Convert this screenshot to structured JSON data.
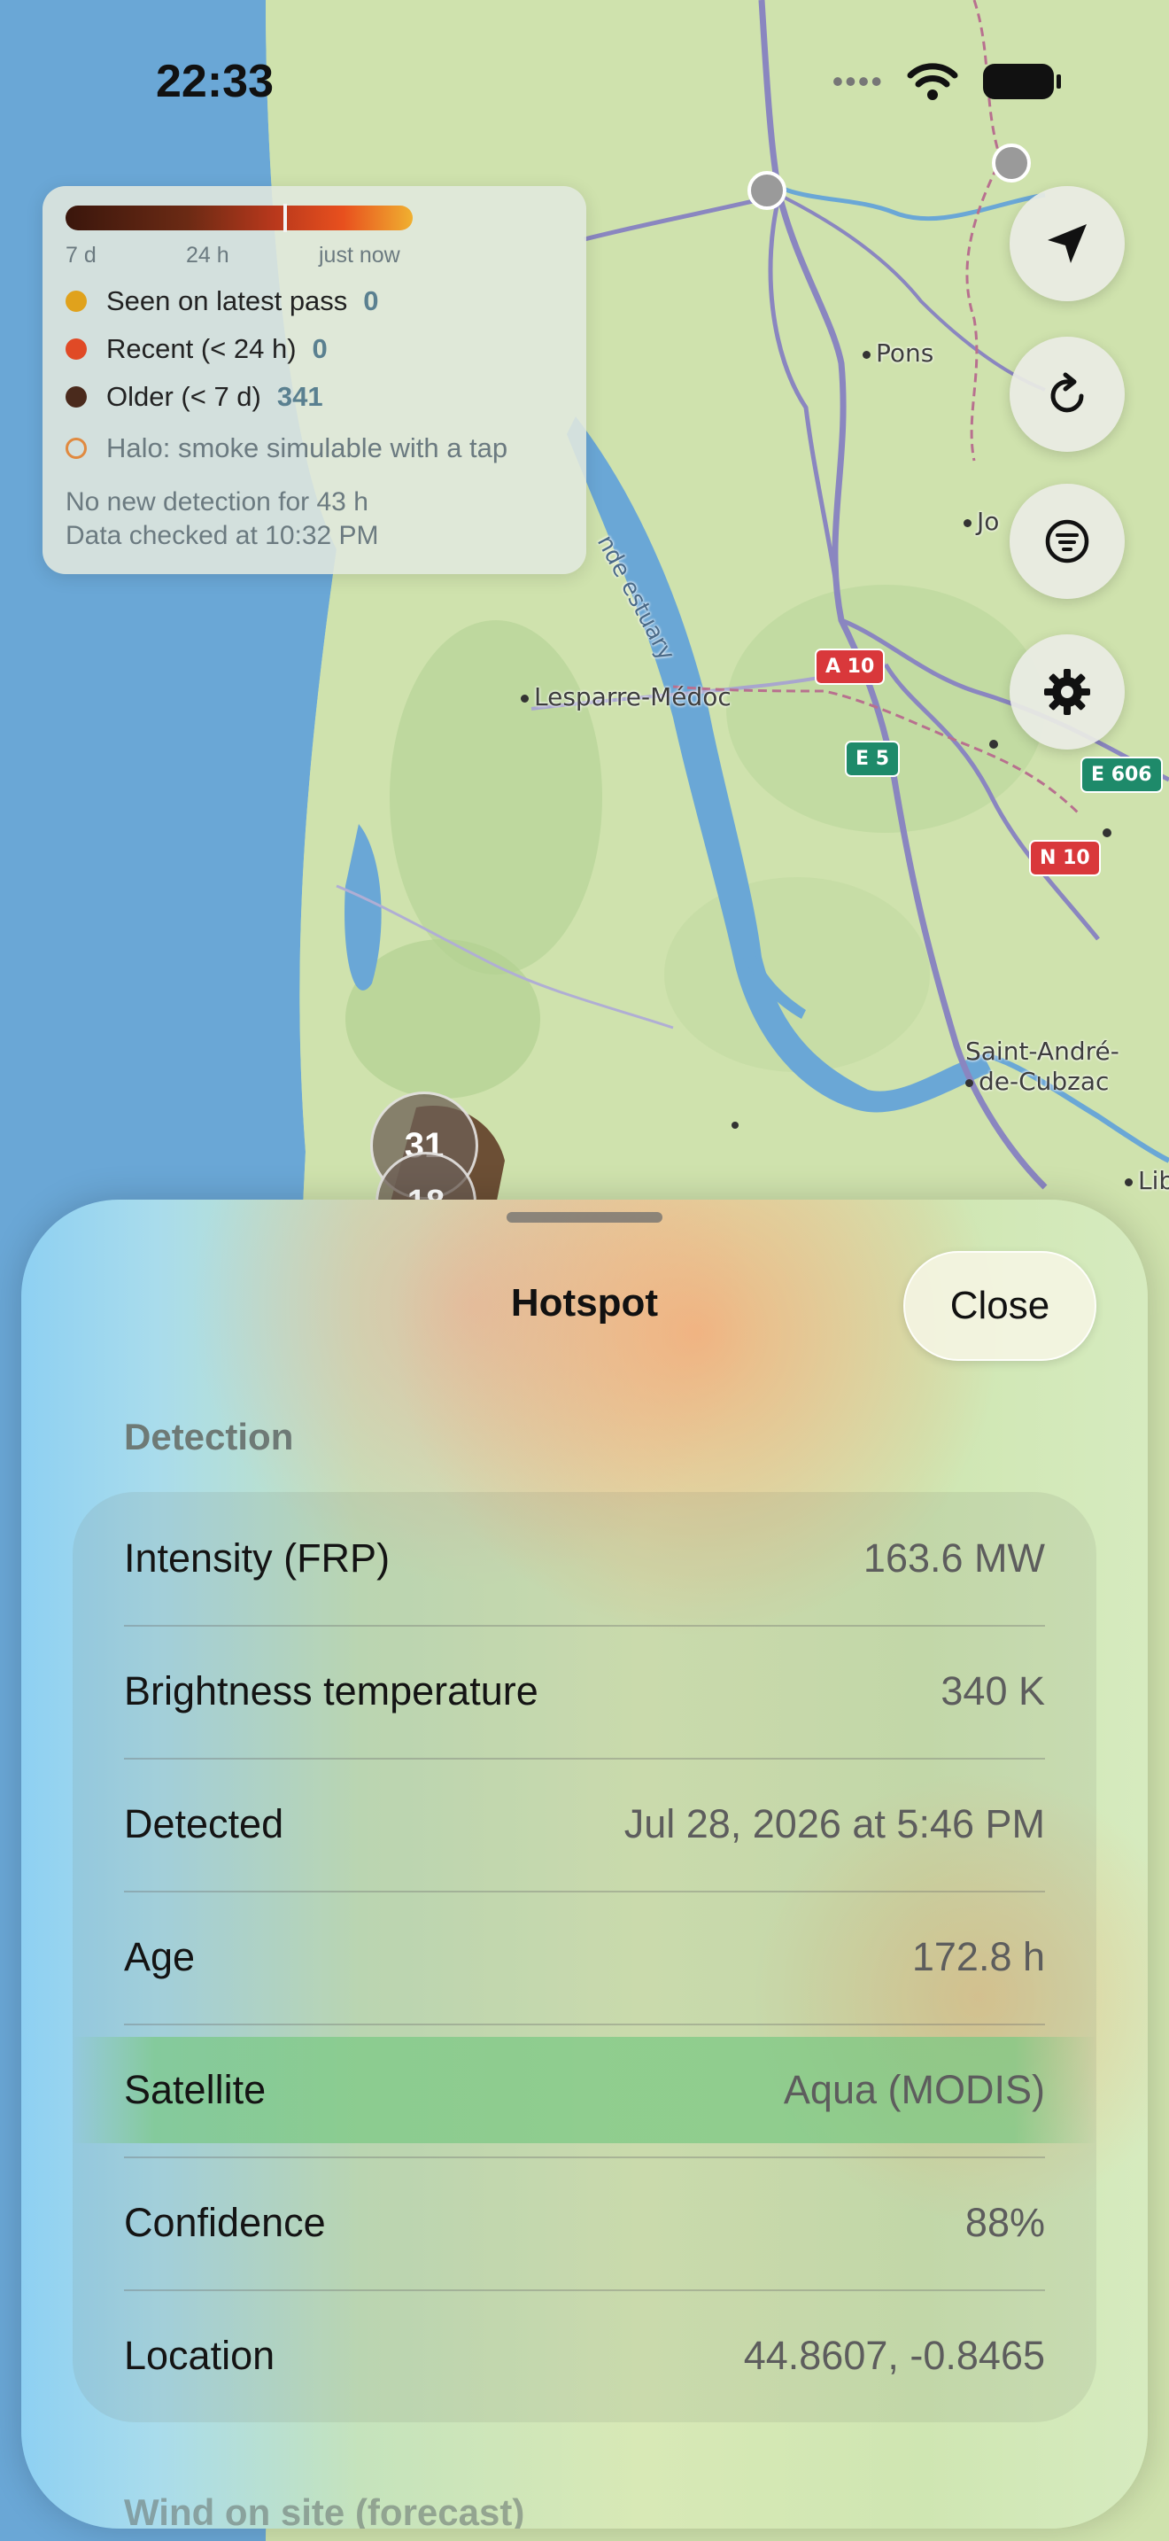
{
  "status_bar": {
    "time": "22:33"
  },
  "legend": {
    "scale_labels": [
      "7 d",
      "24 h",
      "just now"
    ],
    "rows": [
      {
        "label": "Seen on latest pass",
        "count": "0",
        "color": "#e0a21c"
      },
      {
        "label": "Recent (< 24 h)",
        "count": "0",
        "color": "#e04a26"
      },
      {
        "label": "Older (< 7 d)",
        "count": "341",
        "color": "#4a2a1c"
      }
    ],
    "halo_text": "Halo: smoke simulable with a tap",
    "halo_color": "#e08a40",
    "note_line1": "No new detection for 43 h",
    "note_line2": "Data checked at 10:32 PM"
  },
  "controls": [
    "location-arrow-icon",
    "refresh-icon",
    "filter-icon",
    "gear-icon"
  ],
  "map": {
    "places": [
      "Pons",
      "Jo",
      "Lesparre-Médoc",
      "Saint-André-",
      "de-Cubzac",
      "Lib"
    ],
    "estuary_label": "nde estuary",
    "roads": [
      "A 10",
      "E 5",
      "E 606",
      "N 10"
    ],
    "clusters": [
      "31",
      "18"
    ]
  },
  "sheet": {
    "title": "Hotspot",
    "close_label": "Close",
    "section": "Detection",
    "rows": [
      {
        "label": "Intensity (FRP)",
        "value": "163.6 MW"
      },
      {
        "label": "Brightness temperature",
        "value": "340 K"
      },
      {
        "label": "Detected",
        "value": "Jul 28, 2026 at 5:46 PM"
      },
      {
        "label": "Age",
        "value": "172.8 h"
      },
      {
        "label": "Satellite",
        "value": "Aqua (MODIS)"
      },
      {
        "label": "Confidence",
        "value": "88%"
      },
      {
        "label": "Location",
        "value": "44.8607, -0.8465"
      }
    ],
    "next_section": "Wind on site (forecast)"
  }
}
